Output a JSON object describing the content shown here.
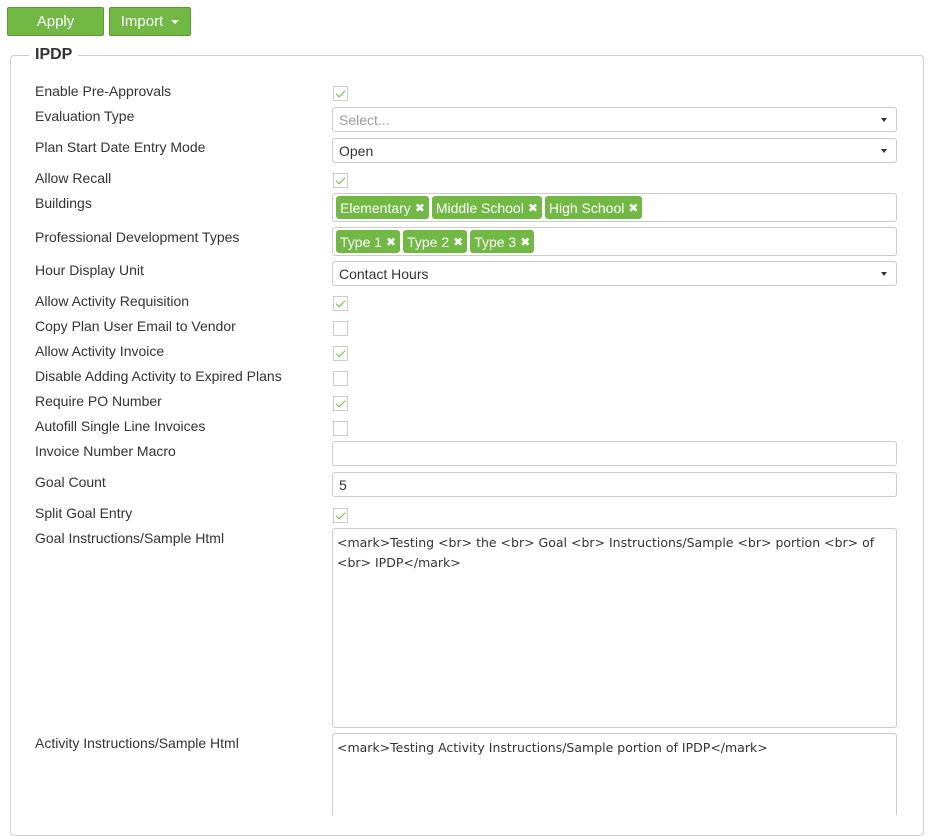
{
  "toolbar": {
    "apply_label": "Apply",
    "import_label": "Import"
  },
  "section": {
    "title": "IPDP"
  },
  "fields": {
    "enable_pre_approvals": {
      "label": "Enable Pre-Approvals",
      "checked": true
    },
    "evaluation_type": {
      "label": "Evaluation Type",
      "value": "",
      "placeholder": "Select..."
    },
    "plan_start_date_entry_mode": {
      "label": "Plan Start Date Entry Mode",
      "value": "Open"
    },
    "allow_recall": {
      "label": "Allow Recall",
      "checked": true
    },
    "buildings": {
      "label": "Buildings",
      "tags": [
        "Elementary",
        "Middle School",
        "High School"
      ]
    },
    "professional_development_types": {
      "label": "Professional Development Types",
      "tags": [
        "Type 1",
        "Type 2",
        "Type 3"
      ]
    },
    "hour_display_unit": {
      "label": "Hour Display Unit",
      "value": "Contact Hours"
    },
    "allow_activity_requisition": {
      "label": "Allow Activity Requisition",
      "checked": true
    },
    "copy_plan_user_email": {
      "label": "Copy Plan User Email to Vendor",
      "checked": false
    },
    "allow_activity_invoice": {
      "label": "Allow Activity Invoice",
      "checked": true
    },
    "disable_adding_activity": {
      "label": "Disable Adding Activity to Expired Plans",
      "checked": false
    },
    "require_po_number": {
      "label": "Require PO Number",
      "checked": true
    },
    "autofill_single_line": {
      "label": "Autofill Single Line Invoices",
      "checked": false
    },
    "invoice_number_macro": {
      "label": "Invoice Number Macro",
      "value": ""
    },
    "goal_count": {
      "label": "Goal Count",
      "value": "5"
    },
    "split_goal_entry": {
      "label": "Split Goal Entry",
      "checked": true
    },
    "goal_instructions": {
      "label": "Goal Instructions/Sample Html",
      "value": "<mark>Testing <br> the <br> Goal <br> Instructions/Sample <br> portion <br> of <br> IPDP</mark>"
    },
    "activity_instructions": {
      "label": "Activity Instructions/Sample Html",
      "value": "<mark>Testing Activity Instructions/Sample portion of IPDP</mark>"
    }
  },
  "colors": {
    "accent": "#72b844",
    "border": "#cccccc",
    "text": "#333333"
  }
}
